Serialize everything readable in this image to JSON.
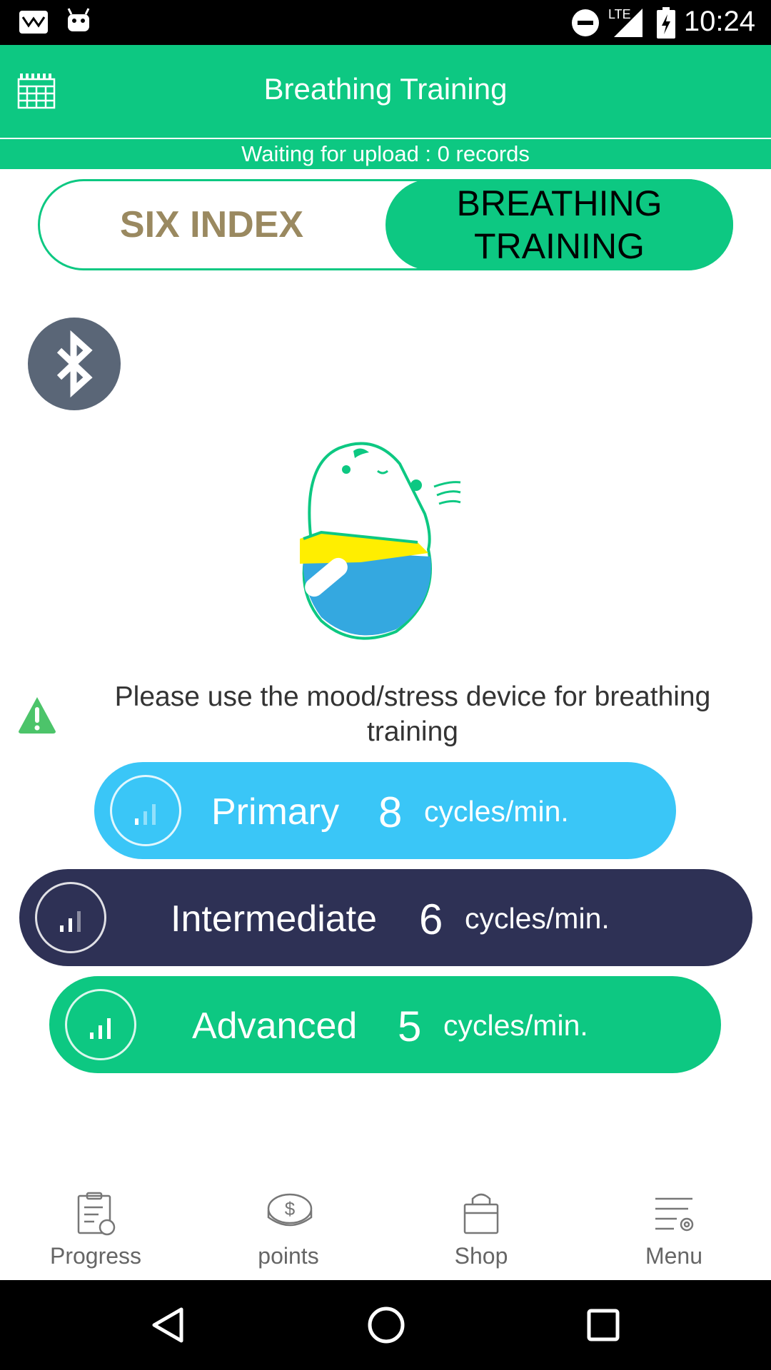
{
  "status_bar": {
    "time": "10:24",
    "network": "LTE"
  },
  "app_bar": {
    "title": "Breathing Training"
  },
  "upload_status": "Waiting for upload : 0 records",
  "tabs": [
    {
      "label": "SIX INDEX",
      "selected": false
    },
    {
      "label": "BREATHING TRAINING",
      "selected": true
    }
  ],
  "notice": "Please use the mood/stress device for breathing training",
  "levels": [
    {
      "name": "Primary",
      "cycles": "8",
      "unit": "cycles/min.",
      "color": "#3ac6f7"
    },
    {
      "name": "Intermediate",
      "cycles": "6",
      "unit": "cycles/min.",
      "color": "#2e3155"
    },
    {
      "name": "Advanced",
      "cycles": "5",
      "unit": "cycles/min.",
      "color": "#0dc882"
    }
  ],
  "bottom_nav": [
    {
      "label": "Progress",
      "icon": "clipboard-icon"
    },
    {
      "label": "points",
      "icon": "coin-icon"
    },
    {
      "label": "Shop",
      "icon": "shopping-bag-icon"
    },
    {
      "label": "Menu",
      "icon": "menu-settings-icon"
    }
  ],
  "colors": {
    "accent": "#0dc882",
    "primary": "#3ac6f7",
    "intermediate": "#2e3155",
    "bluetooth": "#5a6677"
  }
}
